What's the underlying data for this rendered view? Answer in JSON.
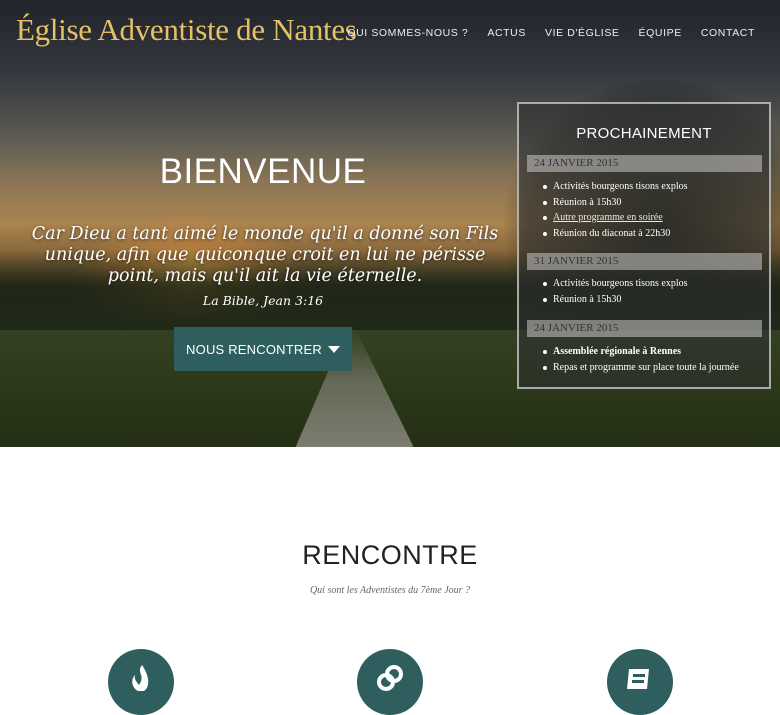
{
  "header": {
    "brand": "Église Adventiste de Nantes",
    "nav": [
      "QUI SOMMES-NOUS ?",
      "ACTUS",
      "VIE D'ÉGLISE",
      "ÉQUIPE",
      "CONTACT"
    ]
  },
  "hero": {
    "welcome": "BIENVENUE",
    "quote": "Car Dieu a tant aimé le monde qu'il a donné son Fils unique, afin que quiconque croit en lui ne périsse point, mais qu'il ait la vie éternelle.",
    "quote_source": "La Bible, Jean 3:16",
    "cta_label": "NOUS RENCONTRER",
    "cta_icon": "caret-down-icon"
  },
  "upcoming": {
    "title": "PROCHAINEMENT",
    "days": [
      {
        "date": "24 JANVIER 2015",
        "events": [
          "Activités bourgeons tisons explos",
          "Réunion à 15h30",
          "Autre programme en soirée",
          "Réunion du diaconat à 22h30"
        ]
      },
      {
        "date": "31 JANVIER 2015",
        "events": [
          "Activités bourgeons tisons explos",
          "Réunion à 15h30"
        ]
      },
      {
        "date": "24 JANVIER 2015",
        "events": [
          "Assemblée régionale à Rennes",
          "Repas et programme sur place toute la journée"
        ]
      }
    ]
  },
  "section": {
    "title": "RENCONTRE",
    "subtitle": "Qui sont les Adventistes du 7ème Jour ?",
    "icons": [
      "flame-icon",
      "link-icon",
      "book-icon"
    ]
  },
  "colors": {
    "accent": "#2e5f5e",
    "brand": "#e4c164"
  }
}
